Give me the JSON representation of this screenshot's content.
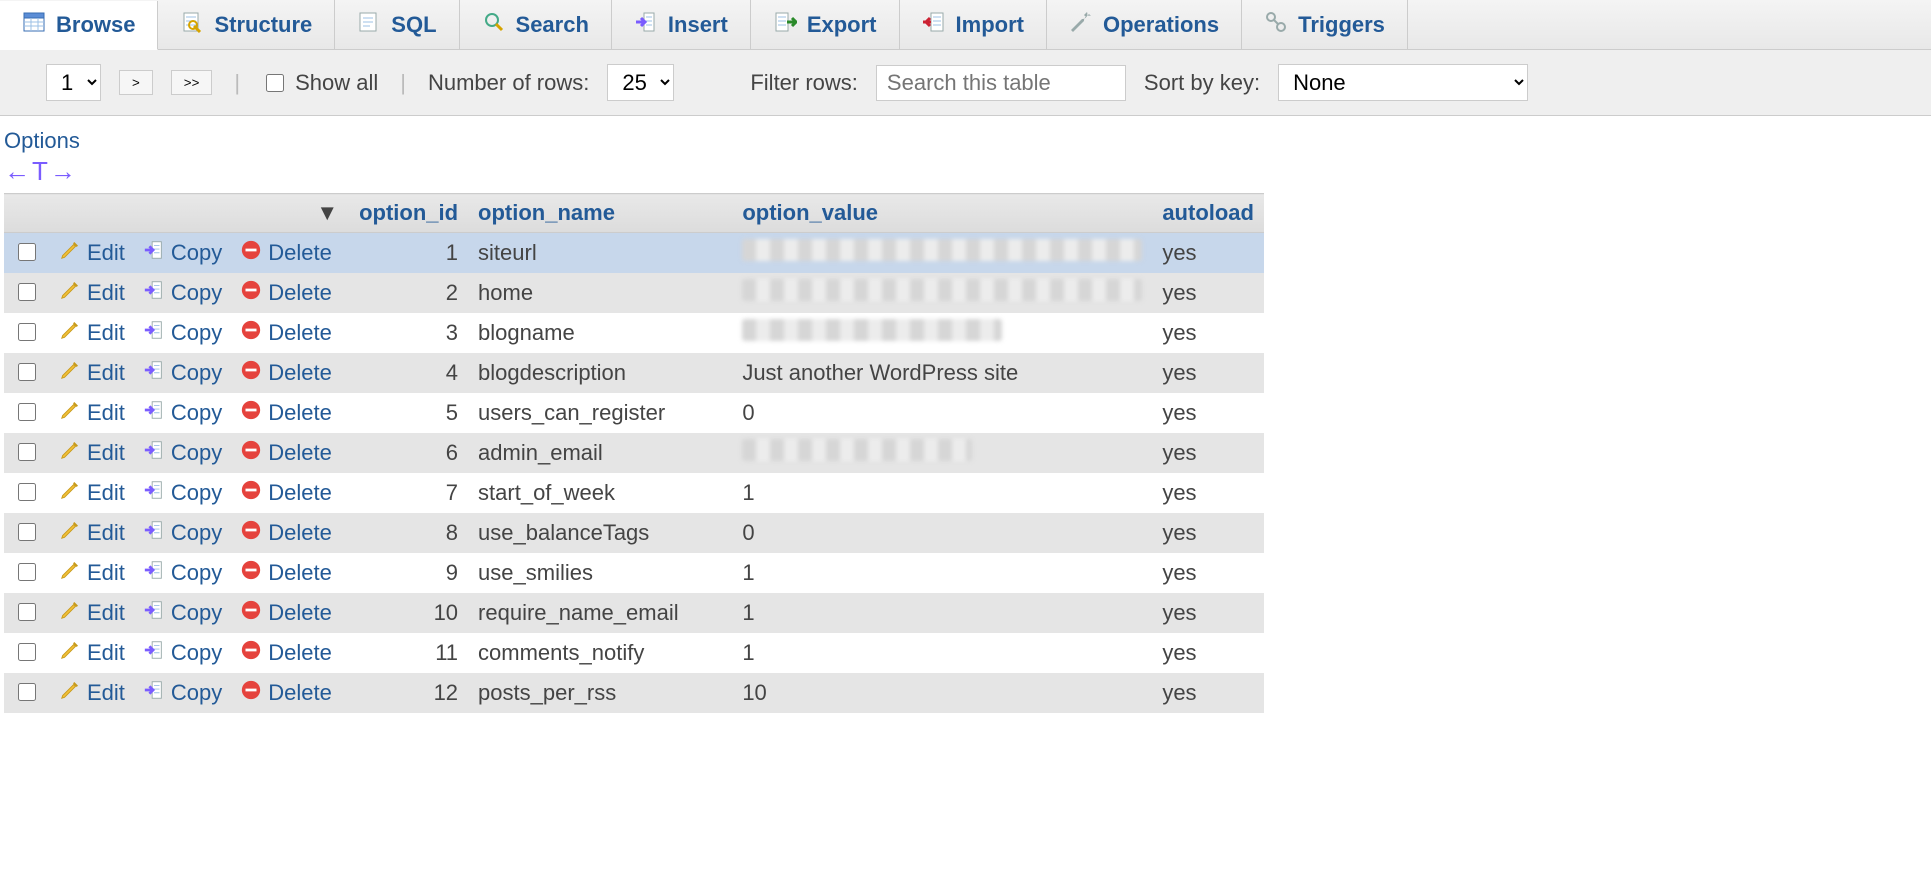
{
  "tabs": [
    {
      "id": "browse",
      "label": "Browse",
      "active": true
    },
    {
      "id": "structure",
      "label": "Structure"
    },
    {
      "id": "sql",
      "label": "SQL"
    },
    {
      "id": "search",
      "label": "Search"
    },
    {
      "id": "insert",
      "label": "Insert"
    },
    {
      "id": "export",
      "label": "Export"
    },
    {
      "id": "import",
      "label": "Import"
    },
    {
      "id": "operations",
      "label": "Operations"
    },
    {
      "id": "triggers",
      "label": "Triggers"
    }
  ],
  "toolbar": {
    "page_selector_value": "1",
    "next_label": ">",
    "last_label": ">>",
    "show_all_label": "Show all",
    "num_rows_label": "Number of rows:",
    "num_rows_value": "25",
    "filter_label": "Filter rows:",
    "filter_placeholder": "Search this table",
    "sort_label": "Sort by key:",
    "sort_value": "None"
  },
  "options_link": "Options",
  "colhead": {
    "option_id": "option_id",
    "option_name": "option_name",
    "option_value": "option_value",
    "autoload": "autoload"
  },
  "row_labels": {
    "edit": "Edit",
    "copy": "Copy",
    "delete": "Delete"
  },
  "rows": [
    {
      "id": 1,
      "name": "siteurl",
      "value": "",
      "value_blur": "long",
      "autoload": "yes",
      "selected": true
    },
    {
      "id": 2,
      "name": "home",
      "value": "",
      "value_blur": "long",
      "autoload": "yes"
    },
    {
      "id": 3,
      "name": "blogname",
      "value": "",
      "value_blur": "short",
      "autoload": "yes"
    },
    {
      "id": 4,
      "name": "blogdescription",
      "value": "Just another WordPress site",
      "autoload": "yes"
    },
    {
      "id": 5,
      "name": "users_can_register",
      "value": "0",
      "autoload": "yes"
    },
    {
      "id": 6,
      "name": "admin_email",
      "value": "",
      "value_blur": "med",
      "autoload": "yes"
    },
    {
      "id": 7,
      "name": "start_of_week",
      "value": "1",
      "autoload": "yes"
    },
    {
      "id": 8,
      "name": "use_balanceTags",
      "value": "0",
      "autoload": "yes"
    },
    {
      "id": 9,
      "name": "use_smilies",
      "value": "1",
      "autoload": "yes"
    },
    {
      "id": 10,
      "name": "require_name_email",
      "value": "1",
      "autoload": "yes"
    },
    {
      "id": 11,
      "name": "comments_notify",
      "value": "1",
      "autoload": "yes"
    },
    {
      "id": 12,
      "name": "posts_per_rss",
      "value": "10",
      "autoload": "yes"
    }
  ]
}
